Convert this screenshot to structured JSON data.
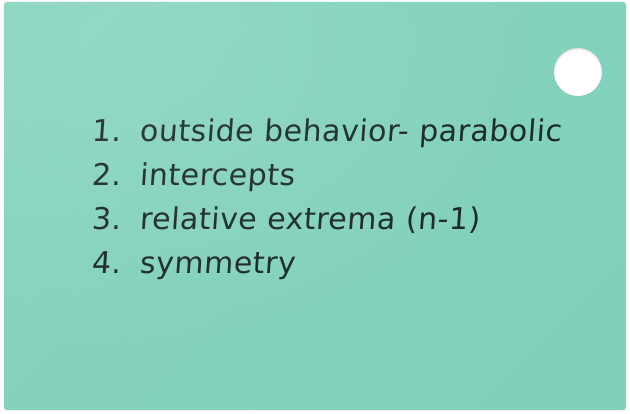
{
  "card": {
    "background_color": "#84d2bd",
    "ink_color": "#1c2a2a",
    "items": [
      {
        "number": "1.",
        "text": "outside behavior- parabolic"
      },
      {
        "number": "2.",
        "text": "intercepts"
      },
      {
        "number": "3.",
        "text": "relative extrema (n-1)"
      },
      {
        "number": "4.",
        "text": "symmetry"
      }
    ]
  }
}
